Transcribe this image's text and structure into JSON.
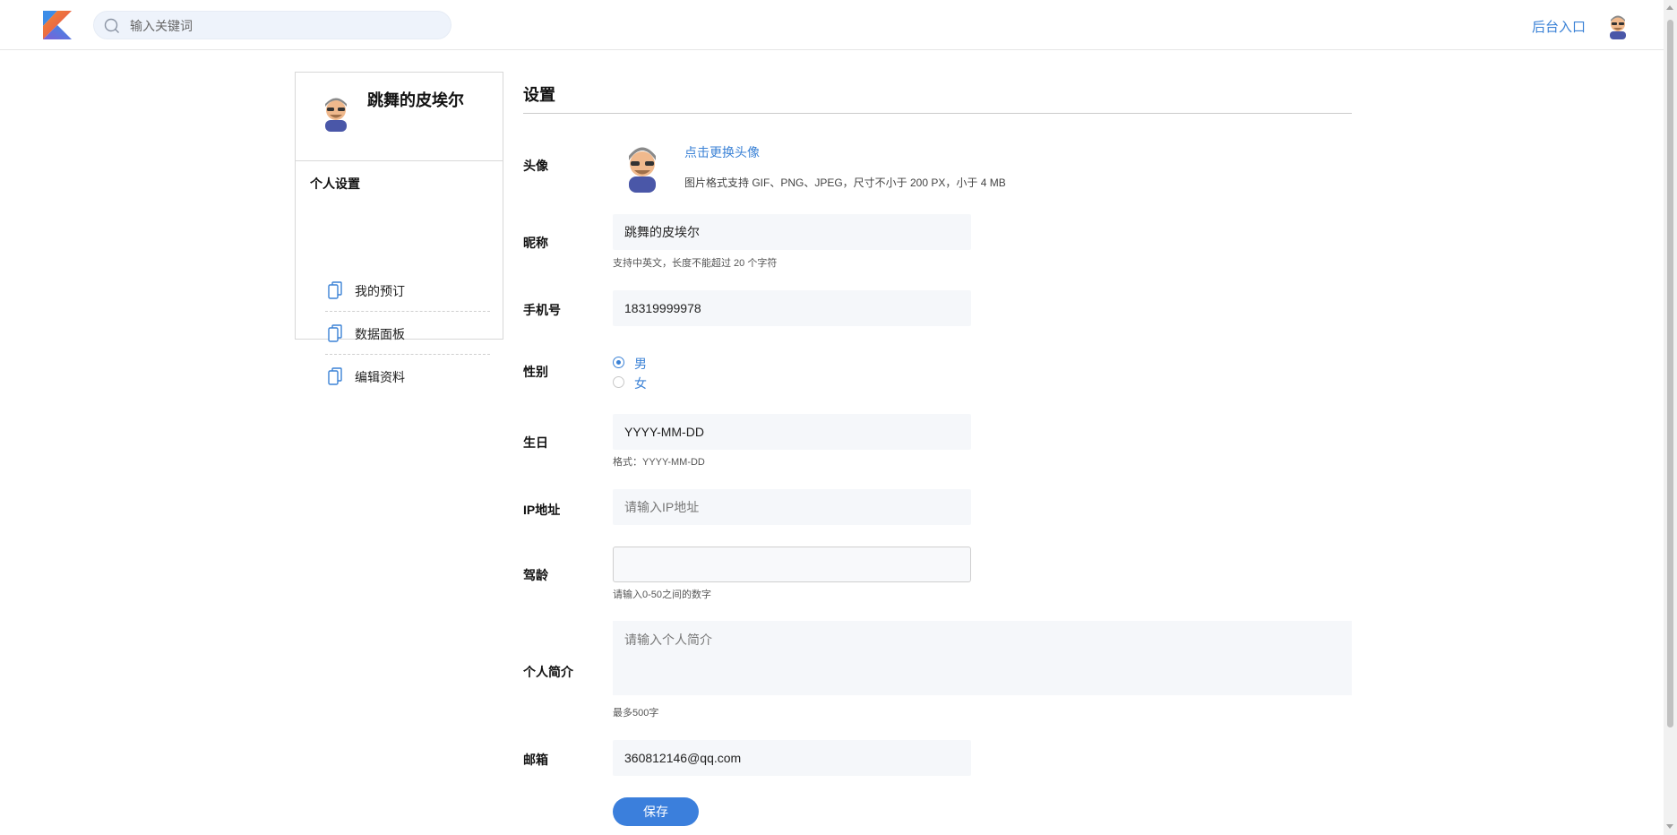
{
  "header": {
    "search": {
      "placeholder": "输入关键词"
    },
    "admin_link": "后台入口",
    "brand_colors": {
      "accent": "#3b82d6",
      "logo_orange": "#f28b30",
      "logo_purple": "#7b5fd6",
      "logo_blue": "#3c8ce7"
    }
  },
  "sidebar": {
    "user_name": "跳舞的皮埃尔",
    "section_title": "个人设置",
    "items": [
      {
        "label": "我的预订",
        "icon": "document-copy-icon"
      },
      {
        "label": "数据面板",
        "icon": "document-copy-icon"
      },
      {
        "label": "编辑资料",
        "icon": "document-copy-icon"
      }
    ]
  },
  "settings": {
    "title": "设置",
    "avatar": {
      "label": "头像",
      "change_link": "点击更换头像",
      "hint": "图片格式支持 GIF、PNG、JPEG，尺寸不小于 200 PX，小于 4 MB"
    },
    "nickname": {
      "label": "昵称",
      "value": "跳舞的皮埃尔",
      "hint": "支持中英文，长度不能超过 20 个字符"
    },
    "phone": {
      "label": "手机号",
      "value": "18319999978"
    },
    "gender": {
      "label": "性别",
      "options": [
        "男",
        "女"
      ],
      "selected": "男"
    },
    "birthday": {
      "label": "生日",
      "value": "YYYY-MM-DD",
      "hint": "格式：YYYY-MM-DD"
    },
    "ip": {
      "label": "IP地址",
      "placeholder": "请输入IP地址"
    },
    "driving_years": {
      "label": "驾龄",
      "value": "",
      "hint": "请输入0-50之间的数字"
    },
    "bio": {
      "label": "个人简介",
      "placeholder": "请输入个人简介",
      "hint": "最多500字"
    },
    "email": {
      "label": "邮箱",
      "value": "360812146@qq.com"
    },
    "save_label": "保存"
  }
}
